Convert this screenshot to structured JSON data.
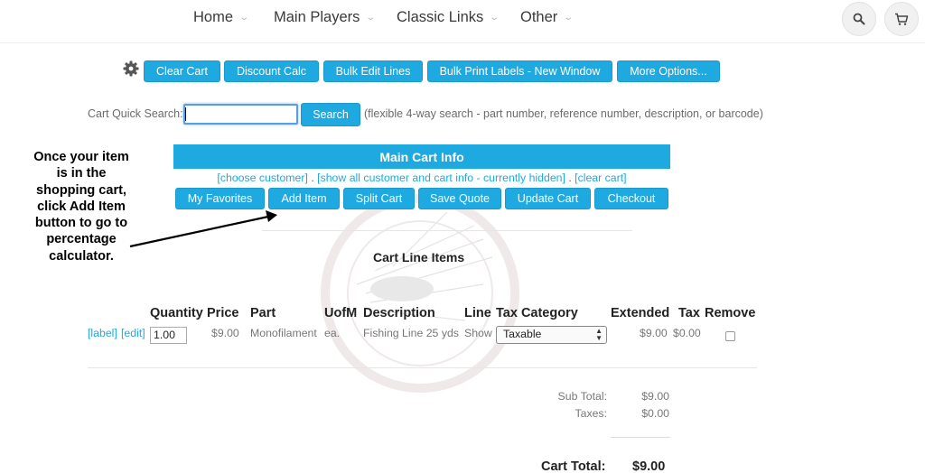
{
  "nav": {
    "items": [
      {
        "label": "Home"
      },
      {
        "label": "Main Players"
      },
      {
        "label": "Classic Links"
      },
      {
        "label": "Other"
      }
    ]
  },
  "toolbar": {
    "clear_cart": "Clear Cart",
    "discount_calc": "Discount Calc",
    "bulk_edit": "Bulk Edit Lines",
    "bulk_print": "Bulk Print Labels - New Window",
    "more_options": "More Options..."
  },
  "search": {
    "label": "Cart Quick Search:",
    "value": "",
    "button": "Search",
    "hint": "(flexible 4-way search - part number, reference number, description, or barcode)"
  },
  "annotation": {
    "text": "Once your item is in the shopping cart, click Add Item button to go to percentage calculator."
  },
  "cart_info": {
    "title": "Main Cart Info",
    "choose_customer": "[choose customer]",
    "show_all": "[show all customer and cart info - currently hidden]",
    "clear_cart": "[clear cart]",
    "sep": " . ",
    "buttons": {
      "favorites": "My Favorites",
      "add_item": "Add Item",
      "split_cart": "Split Cart",
      "save_quote": "Save Quote",
      "update_cart": "Update Cart",
      "checkout": "Checkout"
    }
  },
  "line_items": {
    "title": "Cart Line Items",
    "headers": {
      "quantity": "Quantity",
      "price": "Price",
      "part": "Part",
      "uofm": "UofM",
      "description": "Description",
      "line": "Line",
      "tax_category": "Tax Category",
      "extended": "Extended",
      "tax": "Tax",
      "remove": "Remove"
    },
    "rows": [
      {
        "label_link": "[label]",
        "edit_link": "[edit]",
        "quantity": "1.00",
        "price": "$9.00",
        "part": "Monofilament",
        "uofm": "ea.",
        "description": "Fishing Line 25 yds",
        "line": "Show",
        "tax_category": "Taxable",
        "extended": "$9.00",
        "tax": "$0.00",
        "remove": false
      }
    ]
  },
  "totals": {
    "subtotal_label": "Sub Total:",
    "subtotal_value": "$9.00",
    "taxes_label": "Taxes:",
    "taxes_value": "$0.00",
    "cart_total_label": "Cart Total:",
    "cart_total_value": "$9.00"
  },
  "colors": {
    "accent": "#1fa9e1",
    "text": "#333333"
  },
  "icons": {
    "settings": "gear-icon",
    "search": "search-icon",
    "cart": "shopping-cart-icon"
  }
}
